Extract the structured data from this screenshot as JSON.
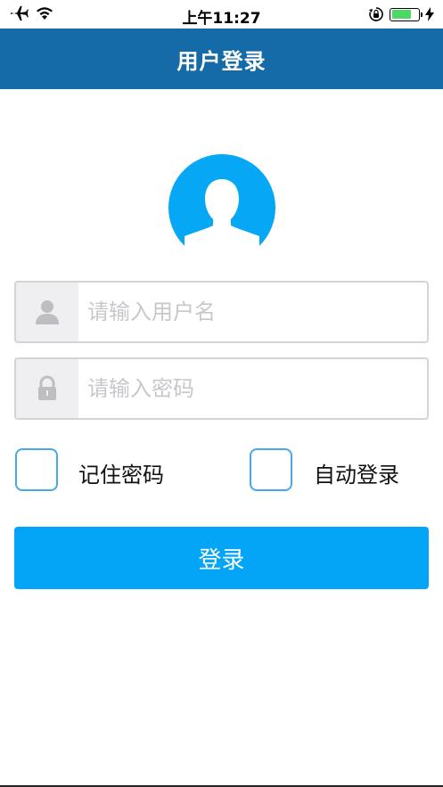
{
  "status_bar": {
    "time": "上午11:27",
    "icons": [
      "airplane-icon",
      "wifi-icon",
      "orientation-lock-icon",
      "battery-icon",
      "charging-icon"
    ],
    "battery_level": 0.78
  },
  "nav": {
    "title": "用户登录"
  },
  "form": {
    "username": {
      "placeholder": "请输入用户名",
      "icon": "person-icon"
    },
    "password": {
      "placeholder": "请输入密码",
      "icon": "lock-icon"
    },
    "remember_label": "记住密码",
    "auto_login_label": "自动登录",
    "submit_label": "登录"
  },
  "colors": {
    "nav_bg": "#156aa8",
    "accent": "#04a5f6",
    "checkbox_border": "#48a8e6",
    "avatar": "#06a7f4"
  }
}
